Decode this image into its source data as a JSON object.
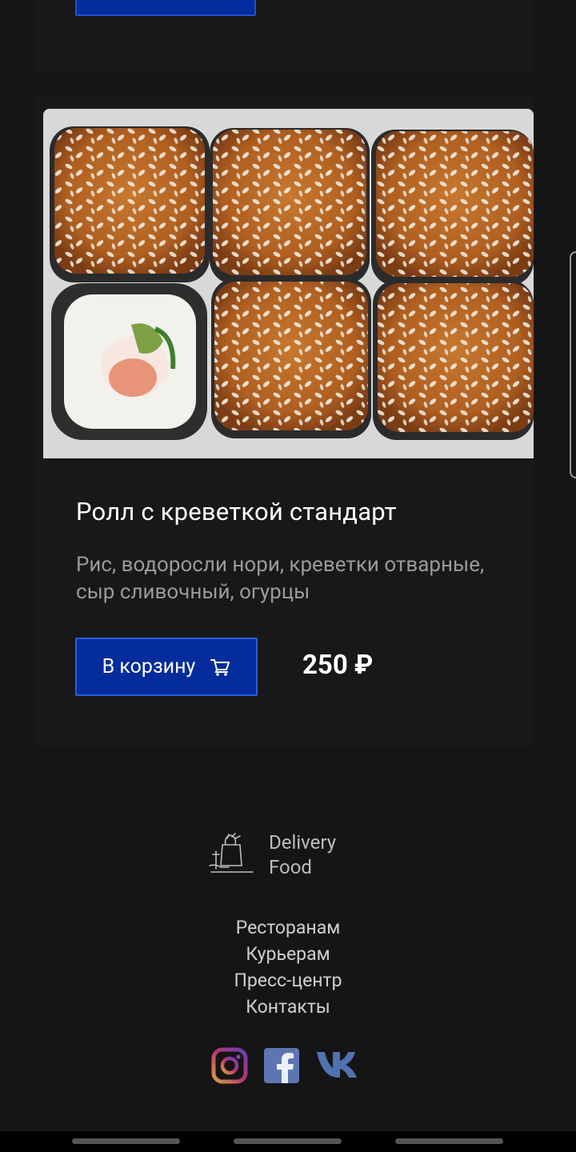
{
  "product": {
    "title": "Ролл с креветкой стандарт",
    "description": "Рис, водоросли нори, креветки отварные, сыр сливочный, огурцы",
    "add_to_cart_label": "В корзину",
    "price": "250 ₽"
  },
  "footer": {
    "logo_line1": "Delivery",
    "logo_line2": "Food",
    "links": [
      "Ресторанам",
      "Курьерам",
      "Пресс-центр",
      "Контакты"
    ],
    "socials": [
      "instagram-icon",
      "facebook-icon",
      "vk-icon"
    ]
  },
  "colors": {
    "background": "#151515",
    "card": "#181818",
    "accent_button": "#052c9c",
    "accent_border": "#2d5ddf"
  }
}
